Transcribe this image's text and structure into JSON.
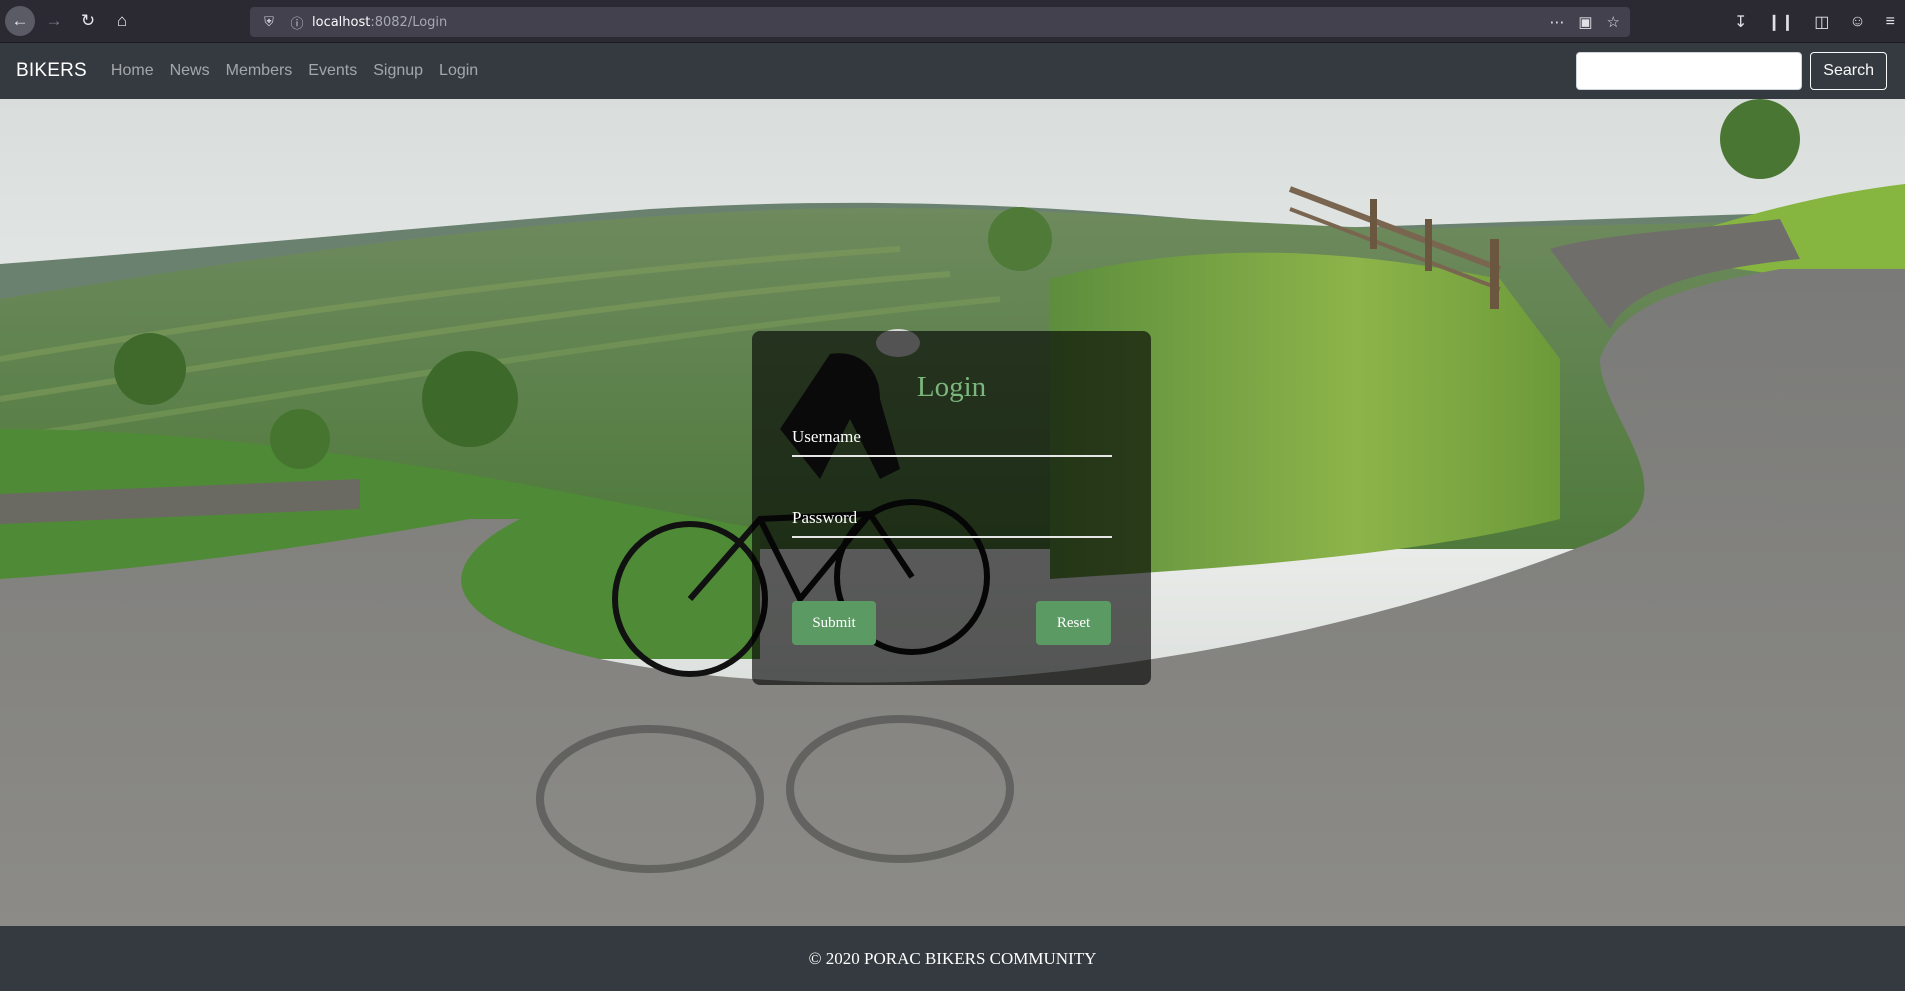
{
  "browser": {
    "url_host": "localhost",
    "url_path": ":8082/Login"
  },
  "navbar": {
    "brand": "BIKERS",
    "links": [
      "Home",
      "News",
      "Members",
      "Events",
      "Signup",
      "Login"
    ],
    "search_button": "Search",
    "search_value": ""
  },
  "login": {
    "title": "Login",
    "username_label": "Username",
    "password_label": "Password",
    "submit_label": "Submit",
    "reset_label": "Reset"
  },
  "footer": {
    "text": "© 2020 PORAC BIKERS COMMUNITY"
  },
  "colors": {
    "navbar_bg": "#343a40",
    "accent_green": "#5c9a64",
    "title_green": "#7bb67d"
  }
}
